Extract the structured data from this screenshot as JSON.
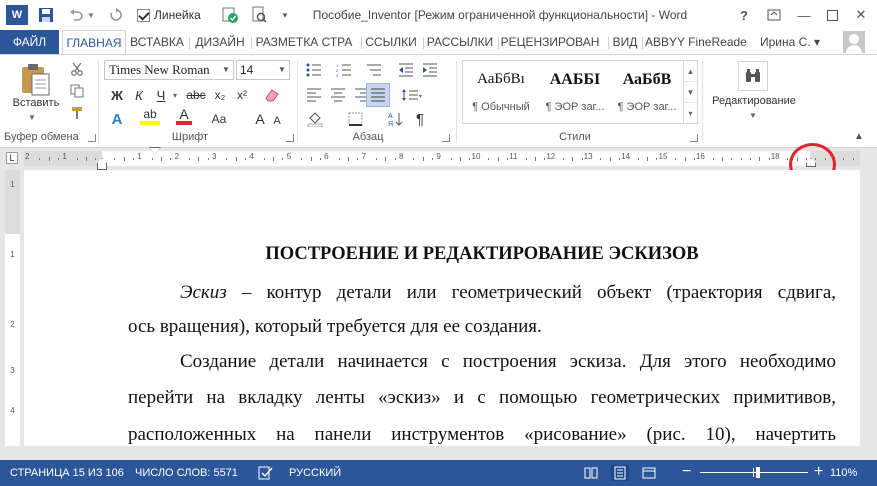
{
  "titlebar": {
    "app_logo": "W",
    "ruler_checkbox_label": "Линейка",
    "ruler_checked": true,
    "document_title": "Пособие_Inventor [Режим ограниченной функциональности] - Word",
    "help": "?",
    "minimize": "—",
    "close": "✕"
  },
  "tabs": {
    "file": "ФАЙЛ",
    "items": [
      "ГЛАВНАЯ",
      "ВСТАВКА",
      "ДИЗАЙН",
      "РАЗМЕТКА СТРА",
      "ССЫЛКИ",
      "РАССЫЛКИ",
      "РЕЦЕНЗИРОВАН",
      "ВИД",
      "ABBYY FineReader"
    ],
    "active": "ГЛАВНАЯ",
    "user": "Ирина С. ▾"
  },
  "ribbon": {
    "clipboard": {
      "paste_label": "Вставить",
      "group_label": "Буфер обмена"
    },
    "font": {
      "name": "Times New Roman",
      "size": "14",
      "group_label": "Шрифт",
      "grow": "A",
      "shrink": "A",
      "case": "Aa",
      "bold": "Ж",
      "italic": "К",
      "underline": "Ч",
      "strike": "abc",
      "subscript": "x₂",
      "superscript": "x²",
      "text_effects": "A",
      "highlight": "ab",
      "font_color": "A",
      "highlight_color": "#ffff00",
      "font_color_value": "#e0252c"
    },
    "paragraph": {
      "group_label": "Абзац",
      "pilcrow": "¶"
    },
    "styles": {
      "group_label": "Стили",
      "items": [
        {
          "sample": "АаБбВı",
          "name": "¶ Обычный"
        },
        {
          "sample": "ААББІ",
          "name": "¶ ЭОР заг..."
        },
        {
          "sample": "АаБбВ",
          "name": "¶ ЭОР заг..."
        }
      ]
    },
    "editing": {
      "label": "Редактирование"
    }
  },
  "ruler": {
    "tab_selector": "L",
    "highlight_color": "#e0252c",
    "numbers": [
      "2",
      "1",
      "1",
      "2",
      "3",
      "4",
      "5",
      "6",
      "7",
      "8",
      "9",
      "10",
      "11",
      "12",
      "13",
      "14",
      "15",
      "16",
      "18"
    ]
  },
  "vertical_ruler": {
    "numbers": [
      "1",
      "1",
      "2",
      "3",
      "4"
    ]
  },
  "document": {
    "heading": "ПОСТРОЕНИЕ И РЕДАКТИРОВАНИЕ ЭСКИЗОВ",
    "p1_term": "Эскиз",
    "p1_line1_rest": " – контур детали или геометрический объект (траектория сдвига,",
    "p1_line2": "ось вращения), который требуется для ее создания.",
    "p2_line1": "Создание детали начинается с построения эскиза. Для этого необходимо",
    "p2_line2": "перейти на вкладку ленты «эскиз» и с помощью геометрических примитивов,",
    "p2_line3": "расположенных на панели инструментов «рисование» (рис. 10), начертить"
  },
  "statusbar": {
    "page": "СТРАНИЦА 15 ИЗ 106",
    "words": "ЧИСЛО СЛОВ: 5571",
    "language": "РУССКИЙ",
    "zoom_minus": "−",
    "zoom_plus": "+",
    "zoom": "110%",
    "color": "#2b579a"
  }
}
